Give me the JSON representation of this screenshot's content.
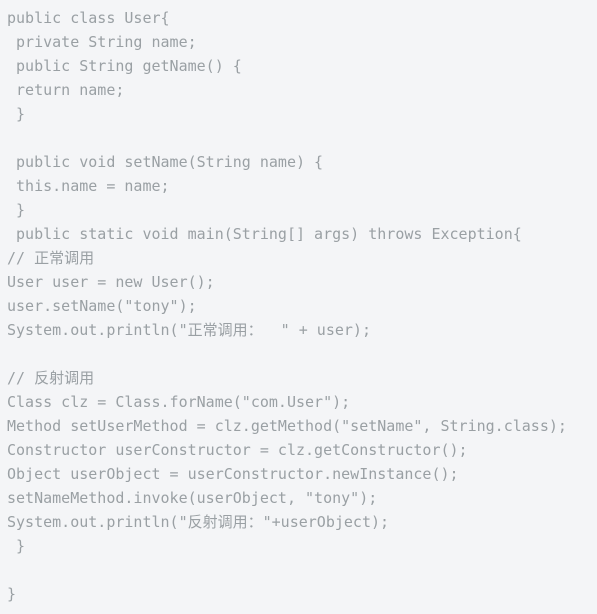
{
  "document": {
    "type": "code-listing",
    "language": "java",
    "background_color": "#f4f5f7",
    "text_color": "#9aa0a4",
    "font_size_px": 15,
    "line_height_px": 24,
    "line_count": 25
  },
  "code": {
    "lines": [
      "public class User{",
      " private String name;",
      " public String getName() {",
      " return name;",
      " }",
      "",
      " public void setName(String name) {",
      " this.name = name;",
      " }",
      " public static void main(String[] args) throws Exception{",
      "// 正常调用",
      "User user = new User();",
      "user.setName(\"tony\");",
      "System.out.println(\"正常调用：  \" + user);",
      "",
      "// 反射调用",
      "Class clz = Class.forName(\"com.User\");",
      "Method setUserMethod = clz.getMethod(\"setName\", String.class);",
      "Constructor userConstructor = clz.getConstructor();",
      "Object userObject = userConstructor.newInstance();",
      "setNameMethod.invoke(userObject, \"tony\");",
      "System.out.println(\"反射调用：\"+userObject);",
      " }",
      "",
      "}"
    ]
  }
}
